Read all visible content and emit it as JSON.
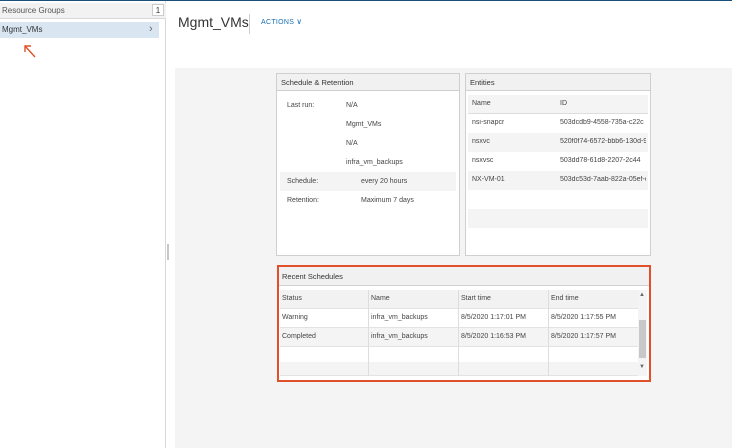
{
  "sidebar": {
    "header_label": "Resource Groups",
    "header_count": "1",
    "selected_item": "Mgmt_VMs"
  },
  "header": {
    "title": "Mgmt_VMs",
    "actions_label": "ACTIONS"
  },
  "schedule_retention": {
    "title": "Schedule & Retention",
    "last_run_label": "Last run:",
    "last_run_values": [
      "N/A",
      "Mgmt_VMs",
      "N/A",
      "infra_vm_backups"
    ],
    "schedule_label": "Schedule:",
    "schedule_value": "every 20 hours",
    "retention_label": "Retention:",
    "retention_value": "Maximum 7 days"
  },
  "entities": {
    "title": "Entities",
    "columns": [
      "Name",
      "ID"
    ],
    "rows": [
      {
        "name": "nsi-snapcr",
        "id": "503dcdb9-4558-735a-c22c"
      },
      {
        "name": "nsxvc",
        "id": "520f0f74-6572-bbb6-130d-9"
      },
      {
        "name": "nsxvsc",
        "id": "503dd78-61d8-2207-2c44"
      },
      {
        "name": "NX-VM-01",
        "id": "503dc53d-7aab-822a-05ef-c"
      }
    ]
  },
  "recent_schedules": {
    "title": "Recent Schedules",
    "columns": [
      "Status",
      "Name",
      "Start time",
      "End time"
    ],
    "rows": [
      {
        "status": "Warning",
        "name": "infra_vm_backups",
        "start": "8/5/2020 1:17:01 PM",
        "end": "8/5/2020 1:17:55 PM"
      },
      {
        "status": "Completed",
        "name": "infra_vm_backups",
        "start": "8/5/2020 1:16:53 PM",
        "end": "8/5/2020 1:17:57 PM"
      }
    ]
  },
  "colors": {
    "accent": "#1a6fb5",
    "highlight_border": "#e0502a",
    "selected_bg": "#d9e6f2"
  },
  "icons": {
    "chevron_right": "chevron-right-icon",
    "chevron_down": "chevron-down-icon",
    "arrow_annotation": "arrow-annotation-icon"
  }
}
